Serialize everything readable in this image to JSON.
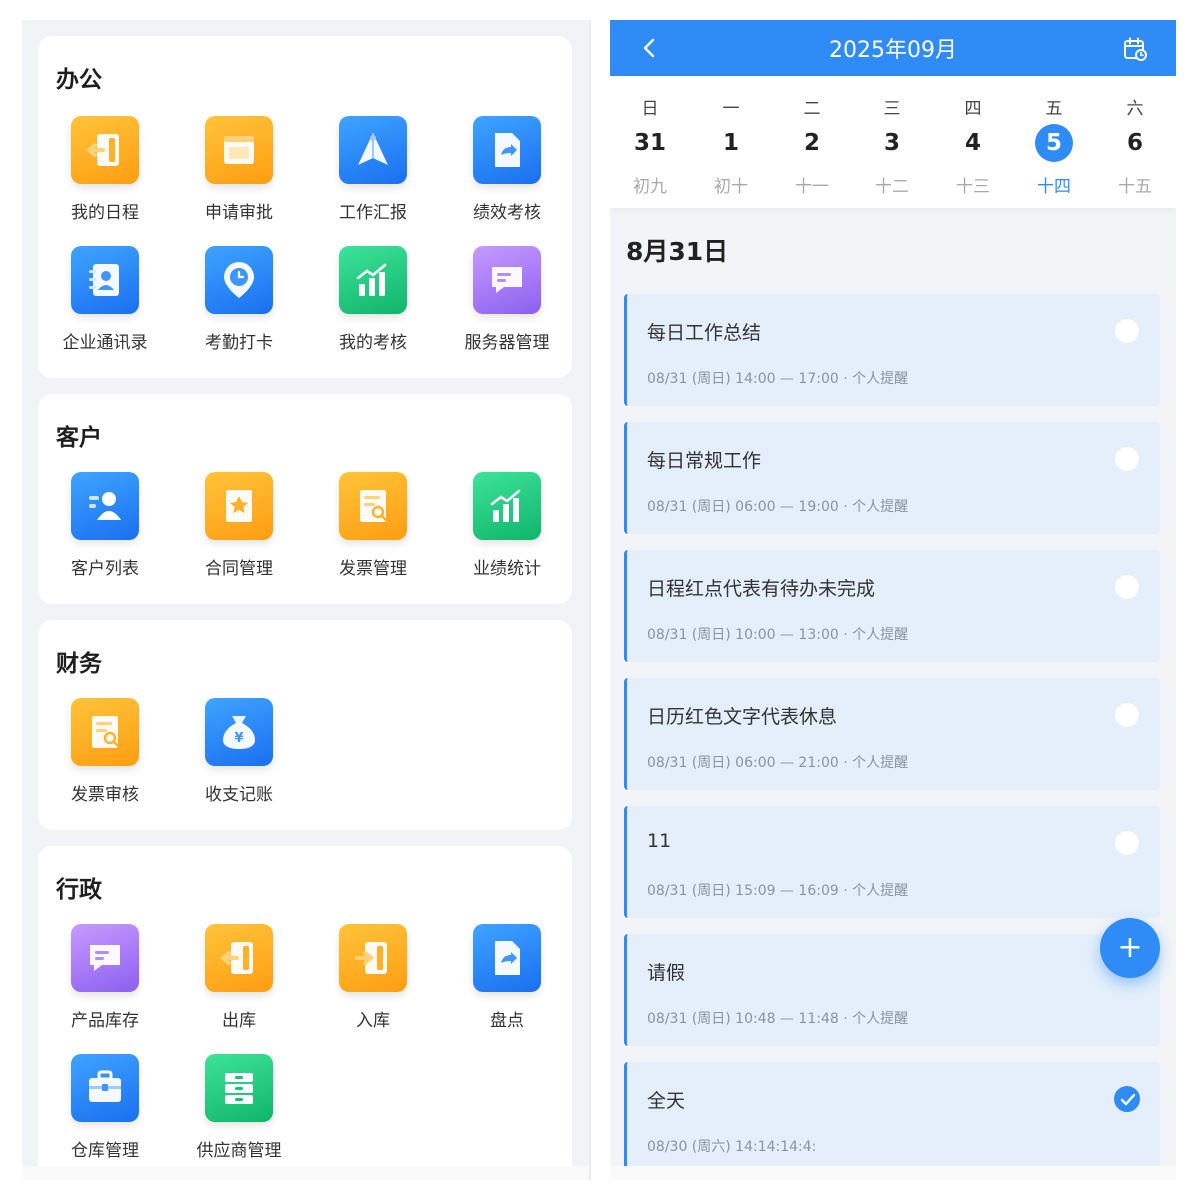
{
  "left": {
    "sections": [
      {
        "title": "办公",
        "apps": [
          {
            "label": "我的日程",
            "icon": "door-exit-icon",
            "color": "#ffa41c"
          },
          {
            "label": "申请审批",
            "icon": "calendar-page-icon",
            "color": "#ffa41c"
          },
          {
            "label": "工作汇报",
            "icon": "paper-plane-icon",
            "color": "#2a7ff5"
          },
          {
            "label": "绩效考核",
            "icon": "document-share-icon",
            "color": "#2a7ff5"
          },
          {
            "label": "企业通讯录",
            "icon": "contact-book-icon",
            "color": "#2a7ff5"
          },
          {
            "label": "考勤打卡",
            "icon": "clock-pin-icon",
            "color": "#2a7ff5"
          },
          {
            "label": "我的考核",
            "icon": "bar-chart-up-icon",
            "color": "#18c07a"
          },
          {
            "label": "服务器管理",
            "icon": "chat-message-icon",
            "color": "#9b6cf5"
          }
        ]
      },
      {
        "title": "客户",
        "apps": [
          {
            "label": "客户列表",
            "icon": "customer-card-icon",
            "color": "#2a7ff5"
          },
          {
            "label": "合同管理",
            "icon": "contract-star-icon",
            "color": "#ffa41c"
          },
          {
            "label": "发票管理",
            "icon": "invoice-search-icon",
            "color": "#ffa41c"
          },
          {
            "label": "业绩统计",
            "icon": "bar-chart-up-icon",
            "color": "#18c07a"
          }
        ]
      },
      {
        "title": "财务",
        "apps": [
          {
            "label": "发票审核",
            "icon": "invoice-search-icon",
            "color": "#ffa41c"
          },
          {
            "label": "收支记账",
            "icon": "money-bag-icon",
            "color": "#2a7ff5"
          }
        ]
      },
      {
        "title": "行政",
        "apps": [
          {
            "label": "产品库存",
            "icon": "chat-message-icon",
            "color": "#9b6cf5"
          },
          {
            "label": "出库",
            "icon": "door-exit-icon",
            "color": "#ffa41c"
          },
          {
            "label": "入库",
            "icon": "door-enter-icon",
            "color": "#ffa41c"
          },
          {
            "label": "盘点",
            "icon": "document-share-icon",
            "color": "#2a7ff5"
          },
          {
            "label": "仓库管理",
            "icon": "briefcase-icon",
            "color": "#2a7ff5"
          },
          {
            "label": "供应商管理",
            "icon": "cabinet-icon",
            "color": "#18c07a"
          }
        ]
      }
    ]
  },
  "calendar": {
    "title": "2025年09月",
    "accent": "#2f8cf7",
    "days": [
      {
        "weekday": "日",
        "num": "31",
        "lunar": "初九",
        "selected": false
      },
      {
        "weekday": "一",
        "num": "1",
        "lunar": "初十",
        "selected": false
      },
      {
        "weekday": "二",
        "num": "2",
        "lunar": "十一",
        "selected": false
      },
      {
        "weekday": "三",
        "num": "3",
        "lunar": "十二",
        "selected": false
      },
      {
        "weekday": "四",
        "num": "4",
        "lunar": "十三",
        "selected": false
      },
      {
        "weekday": "五",
        "num": "5",
        "lunar": "十四",
        "selected": true
      },
      {
        "weekday": "六",
        "num": "6",
        "lunar": "十五",
        "selected": false
      }
    ],
    "selected_date_heading": "8月31日",
    "events": [
      {
        "title": "每日工作总结",
        "meta": "08/31 (周日) 14:00 — 17:00 · 个人提醒",
        "done": false
      },
      {
        "title": "每日常规工作",
        "meta": "08/31 (周日) 06:00 — 19:00 · 个人提醒",
        "done": false
      },
      {
        "title": "日程红点代表有待办未完成",
        "meta": "08/31 (周日) 10:00 — 13:00 · 个人提醒",
        "done": false
      },
      {
        "title": "日历红色文字代表休息",
        "meta": "08/31 (周日) 06:00 — 21:00 · 个人提醒",
        "done": false
      },
      {
        "title": "11",
        "meta": "08/31 (周日) 15:09 — 16:09 · 个人提醒",
        "done": false
      },
      {
        "title": "请假",
        "meta": "08/31 (周日) 10:48 — 11:48 · 个人提醒",
        "done": false
      },
      {
        "title": "全天",
        "meta": "08/30 (周六) 14:14:14:4:",
        "done": true
      }
    ],
    "fab_label": "+"
  }
}
